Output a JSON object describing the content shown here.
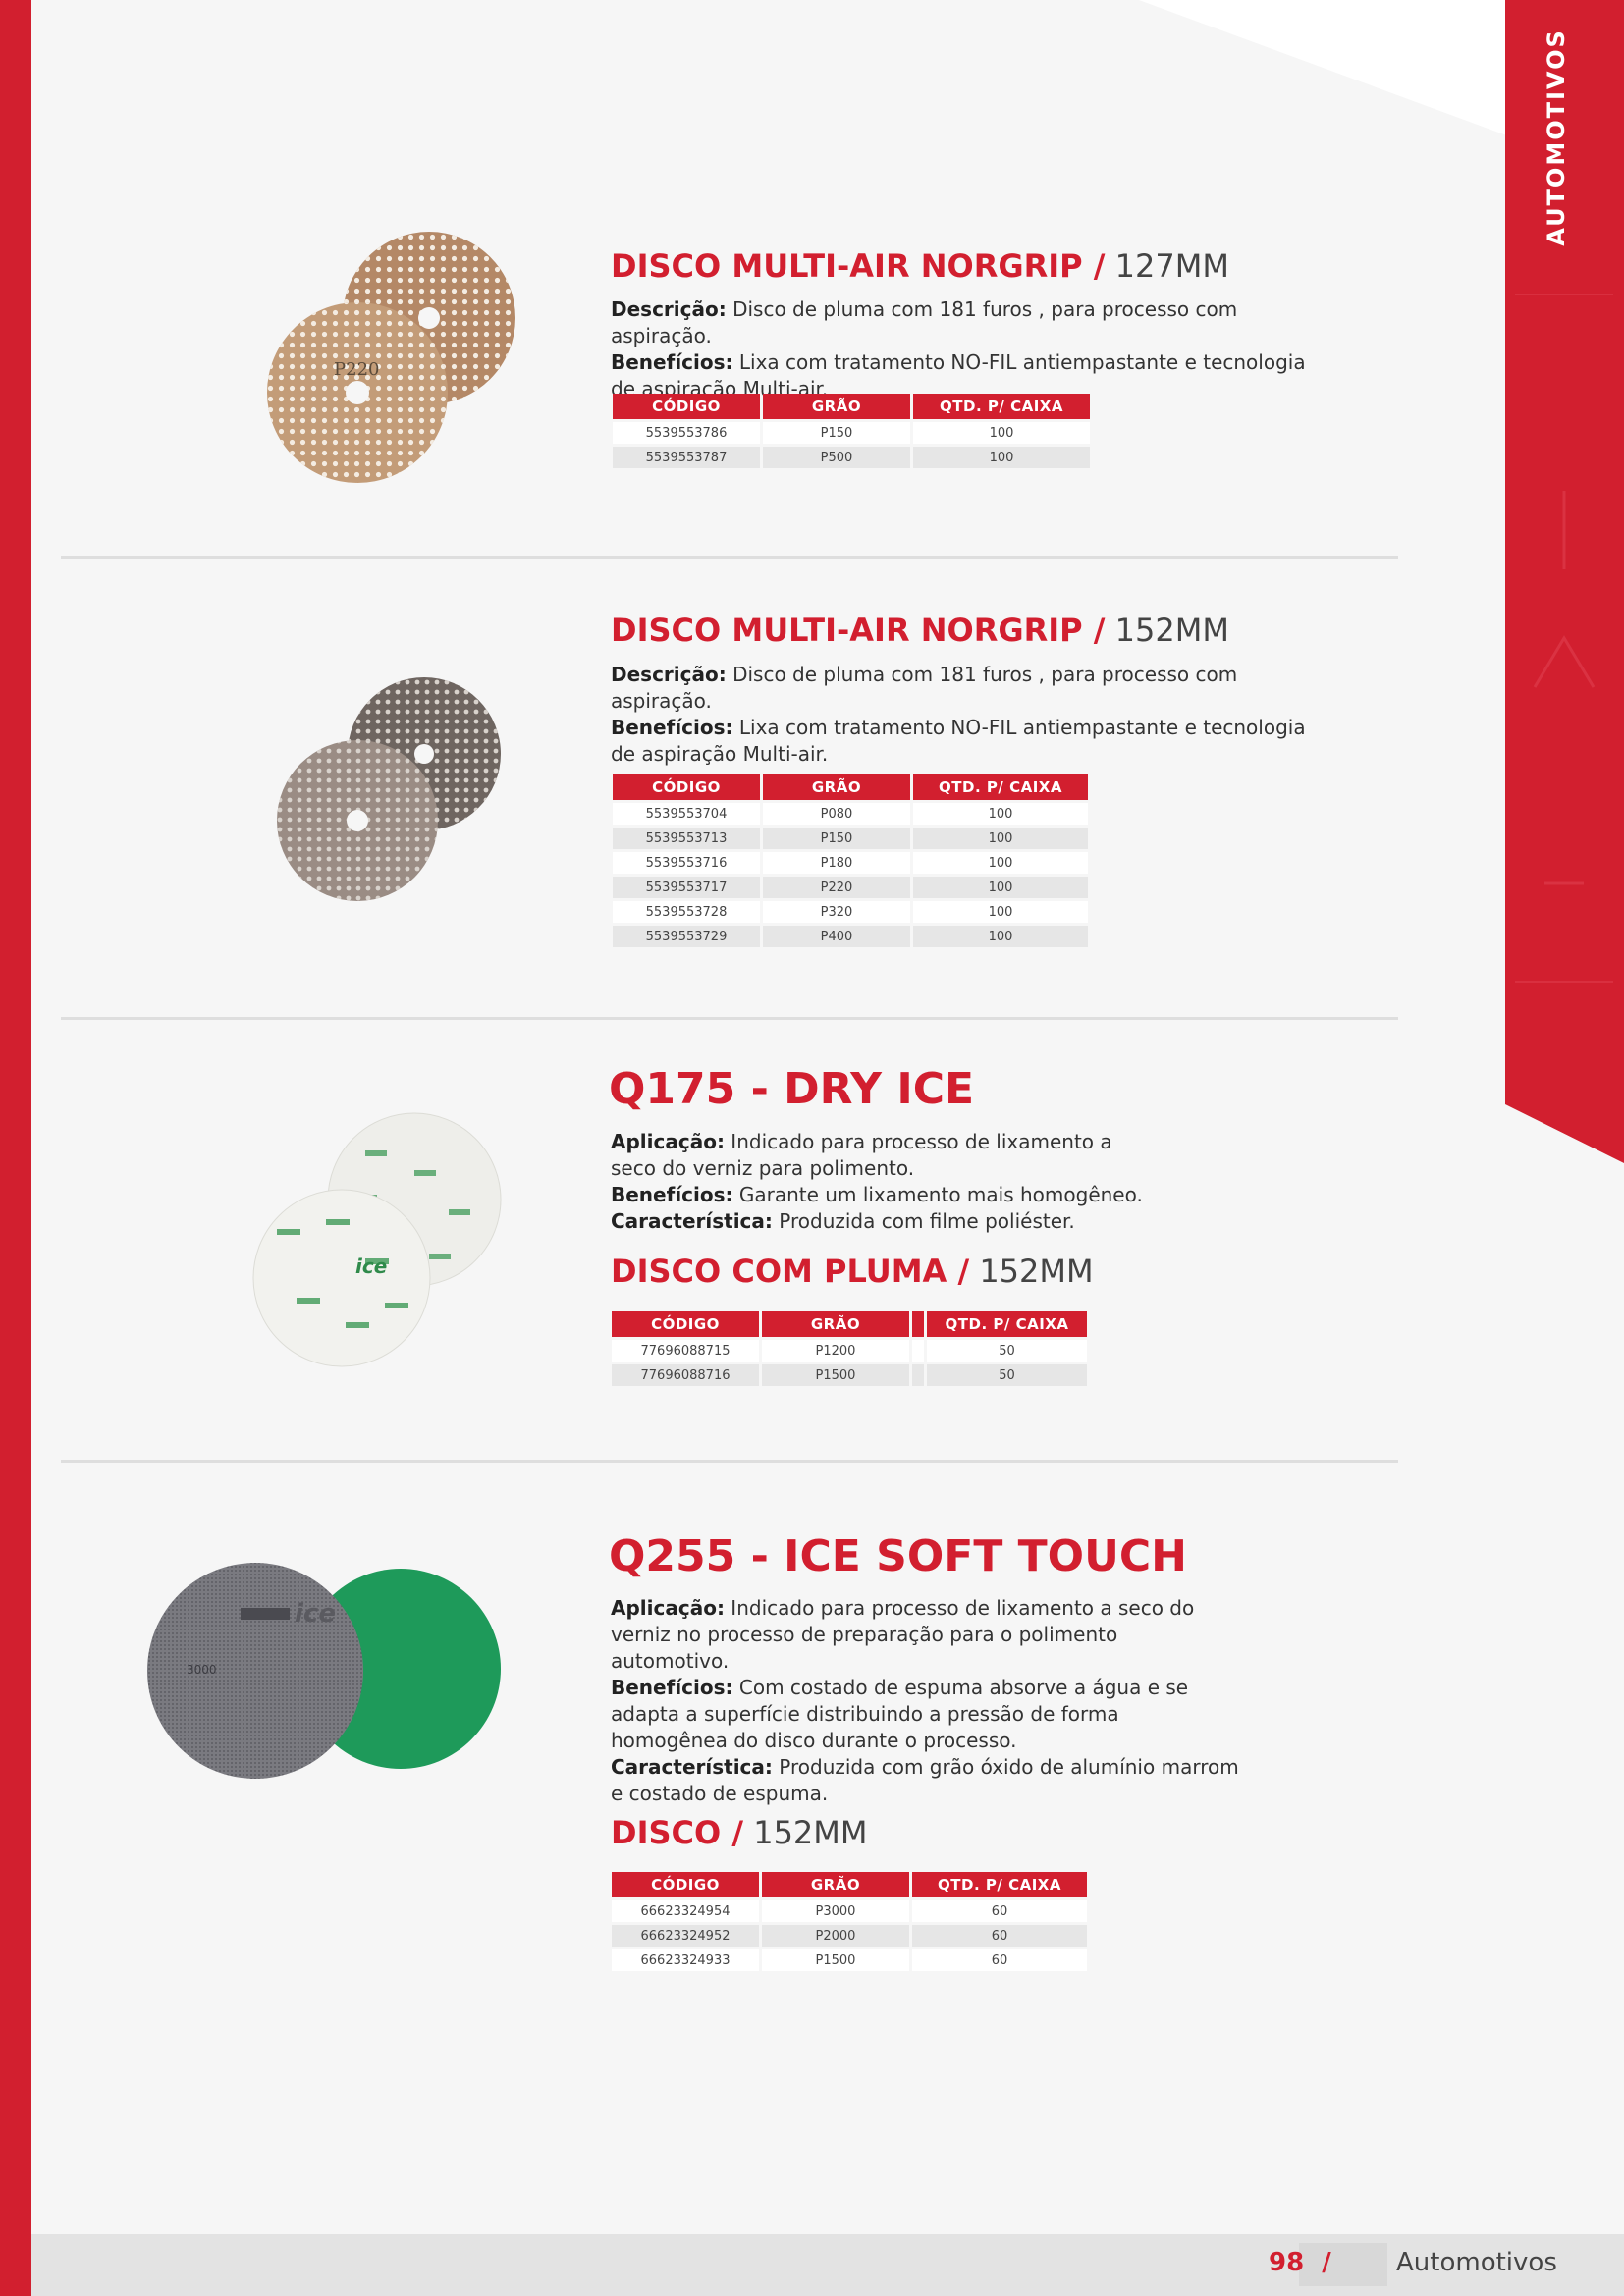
{
  "side_label": "AUTOMOTIVOS",
  "colors": {
    "brand_red": "#d21f2f",
    "row_alt": "#e6e6e6"
  },
  "products": [
    {
      "title_bold": "DISCO MULTI-AIR NORGRIP /",
      "title_thin": "127MM",
      "lines": [
        {
          "label": "Descrição:",
          "text": " Disco de pluma com 181 furos , para processo com aspiração."
        },
        {
          "label": "Benefícios:",
          "text": " Lixa com tratamento NO-FIL antiempastante e tecnologia de aspiração Multi-air."
        }
      ],
      "disc_text": "P220",
      "table": {
        "headers": [
          "CÓDIGO",
          "GRÃO",
          "QTD. P/ CAIXA"
        ],
        "rows": [
          [
            "5539553786",
            "P150",
            "100"
          ],
          [
            "5539553787",
            "P500",
            "100"
          ]
        ]
      }
    },
    {
      "title_bold": "DISCO MULTI-AIR NORGRIP /",
      "title_thin": "152MM",
      "lines": [
        {
          "label": "Descrição:",
          "text": " Disco de pluma com 181 furos , para processo com aspiração."
        },
        {
          "label": "Benefícios:",
          "text": " Lixa com tratamento NO-FIL antiempastante e tecnologia de aspiração Multi-air."
        }
      ],
      "table": {
        "headers": [
          "CÓDIGO",
          "GRÃO",
          "QTD. P/ CAIXA"
        ],
        "rows": [
          [
            "5539553704",
            "P080",
            "100"
          ],
          [
            "5539553713",
            "P150",
            "100"
          ],
          [
            "5539553716",
            "P180",
            "100"
          ],
          [
            "5539553717",
            "P220",
            "100"
          ],
          [
            "5539553728",
            "P320",
            "100"
          ],
          [
            "5539553729",
            "P400",
            "100"
          ]
        ]
      }
    },
    {
      "title_bold": "Q175 - DRY ICE",
      "lines": [
        {
          "label": "Aplicação:",
          "text": " Indicado para processo de lixamento a seco do verniz para polimento."
        },
        {
          "label": "Benefícios:",
          "text": " Garante um lixamento mais homogêneo."
        },
        {
          "label": "Característica:",
          "text": " Produzida com filme poliéster."
        }
      ],
      "disc_text": "ice",
      "sub_title_bold": "DISCO COM PLUMA /",
      "sub_title_thin": "152MM",
      "table": {
        "headers": [
          "CÓDIGO",
          "GRÃO",
          "",
          "QTD. P/ CAIXA"
        ],
        "rows": [
          [
            "77696088715",
            "P1200",
            "",
            "50"
          ],
          [
            "77696088716",
            "P1500",
            "",
            "50"
          ]
        ]
      }
    },
    {
      "title_bold": "Q255 - ICE SOFT TOUCH",
      "lines": [
        {
          "label": "Aplicação:",
          "text": " Indicado para processo de lixamento a seco do verniz no processo de preparação para o polimento automotivo."
        },
        {
          "label": "Benefícios:",
          "text": "  Com costado de espuma absorve a água e se adapta a superfície distribuindo a pressão de forma homogênea do disco durante o processo."
        },
        {
          "label": "Característica:",
          "text": " Produzida com grão óxido de alumínio marrom e costado de espuma."
        }
      ],
      "disc_text": "3000",
      "sub_title_bold": "DISCO /",
      "sub_title_thin": "152MM",
      "table": {
        "headers": [
          "CÓDIGO",
          "GRÃO",
          "QTD. P/ CAIXA"
        ],
        "rows": [
          [
            "66623324954",
            "P3000",
            "60"
          ],
          [
            "66623324952",
            "P2000",
            "60"
          ],
          [
            "66623324933",
            "P1500",
            "60"
          ]
        ]
      }
    }
  ],
  "footer": {
    "page_number": "98",
    "separator": "/",
    "section": "Automotivos"
  }
}
